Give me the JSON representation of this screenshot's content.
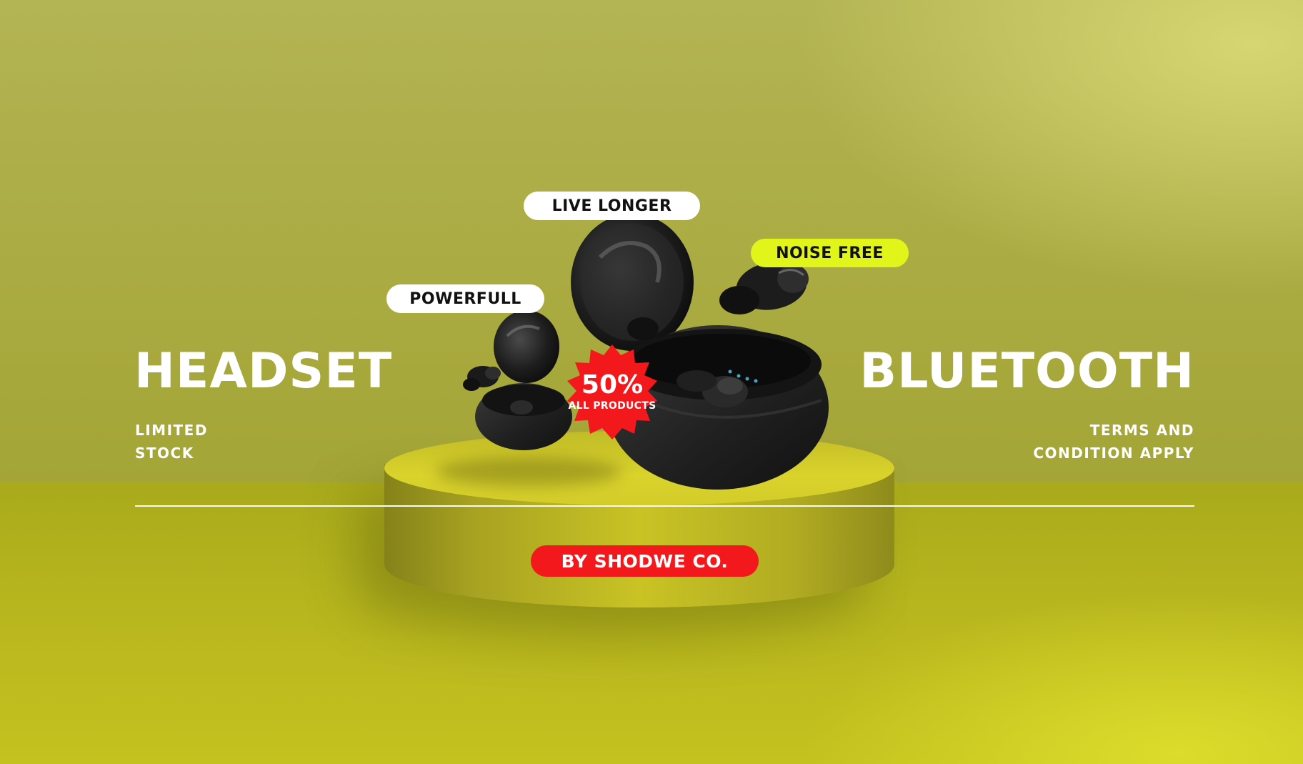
{
  "tags": {
    "live": "LIVE LONGER",
    "noise": "NOISE FREE",
    "power": "POWERFULL"
  },
  "headline_left": "HEADSET",
  "headline_right": "BLUETOOTH",
  "note_left": [
    "LIMITED",
    "STOCK"
  ],
  "note_right": [
    "TERMS AND",
    "CONDITION APPLY"
  ],
  "discount": {
    "percent": "50%",
    "label": "ALL PRODUCTS"
  },
  "brand": "BY SHODWE CO.",
  "colors": {
    "background": "#a9aa40",
    "accent_yellow": "#e2f51b",
    "accent_red": "#f3181c",
    "product": "#1c1c1c"
  }
}
